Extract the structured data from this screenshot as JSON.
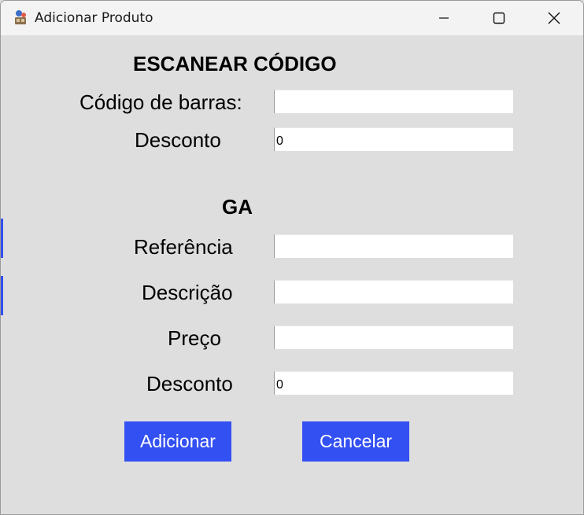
{
  "window": {
    "title": "Adicionar Produto",
    "icons": {
      "app": "app-logo-icon",
      "minimize": "minimize-icon",
      "maximize": "maximize-icon",
      "close": "close-icon"
    }
  },
  "scan_section": {
    "heading": "ESCANEAR  CÓDIGO",
    "barcode_label": "Código de barras:",
    "barcode_value": "",
    "discount_label": "Desconto",
    "discount_value": "0"
  },
  "ga_section": {
    "heading": "GA",
    "reference_label": "Referência",
    "reference_value": "",
    "description_label": "Descrição",
    "description_value": "",
    "price_label": "Preço",
    "price_value": "",
    "discount_label": "Desconto",
    "discount_value": "0"
  },
  "buttons": {
    "add": "Adicionar",
    "cancel": "Cancelar"
  },
  "colors": {
    "button_bg": "#3350f2",
    "window_bg": "#dedede",
    "titlebar_bg": "#f3f3f3"
  }
}
